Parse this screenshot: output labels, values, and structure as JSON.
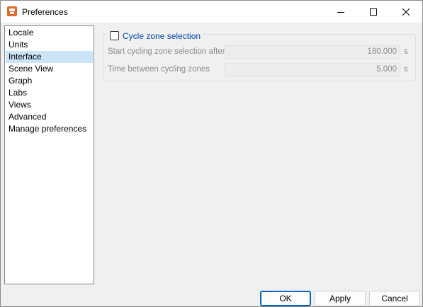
{
  "window": {
    "title": "Preferences",
    "icons": {
      "app": "app-logo-icon",
      "minimize": "minimize-icon",
      "maximize": "maximize-icon",
      "close": "close-icon"
    }
  },
  "sidebar": {
    "items": [
      {
        "label": "Locale",
        "selected": false
      },
      {
        "label": "Units",
        "selected": false
      },
      {
        "label": "Interface",
        "selected": true
      },
      {
        "label": "Scene View",
        "selected": false
      },
      {
        "label": "Graph",
        "selected": false
      },
      {
        "label": "Labs",
        "selected": false
      },
      {
        "label": "Views",
        "selected": false
      },
      {
        "label": "Advanced",
        "selected": false
      },
      {
        "label": "Manage preferences",
        "selected": false
      }
    ]
  },
  "interface": {
    "cycle_group": {
      "label": "Cycle zone selection",
      "checked": false,
      "fields": [
        {
          "label": "Start cycling zone selection after",
          "value": "180.000",
          "unit": "s"
        },
        {
          "label": "Time between cycling zones",
          "value": "5.000",
          "unit": "s"
        }
      ]
    }
  },
  "buttons": {
    "ok": "OK",
    "apply": "Apply",
    "cancel": "Cancel"
  },
  "colors": {
    "selection": "#cce4f7",
    "group_label": "#0046ad",
    "default_button_border": "#0067c0",
    "app_icon": "#e8652a"
  }
}
